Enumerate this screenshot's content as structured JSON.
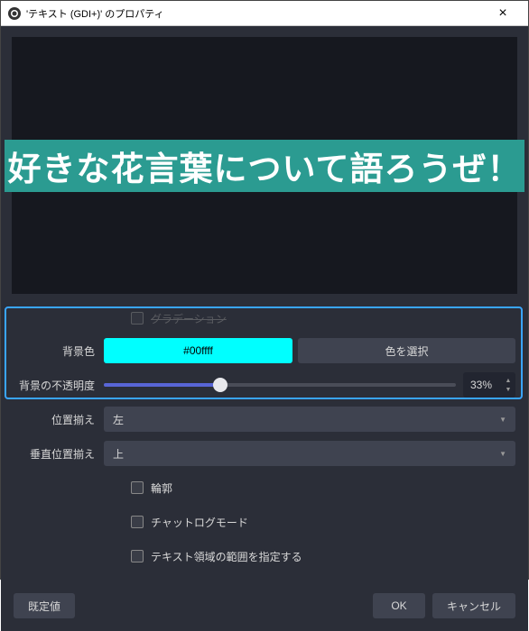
{
  "window": {
    "title": "'テキスト (GDI+)' のプロパティ"
  },
  "preview": {
    "text": "好きな花言葉について語ろうぜ！"
  },
  "form": {
    "gradation": {
      "label": "グラデーション"
    },
    "bg_color": {
      "label": "背景色",
      "value": "#00ffff",
      "pick": "色を選択"
    },
    "bg_opacity": {
      "label": "背景の不透明度",
      "value": "33%"
    },
    "align": {
      "label": "位置揃え",
      "value": "左"
    },
    "valign": {
      "label": "垂直位置揃え",
      "value": "上"
    },
    "outline": {
      "label": "輪郭"
    },
    "chatlog": {
      "label": "チャットログモード"
    },
    "extents": {
      "label": "テキスト領域の範囲を指定する"
    }
  },
  "buttons": {
    "defaults": "既定値",
    "ok": "OK",
    "cancel": "キャンセル"
  }
}
